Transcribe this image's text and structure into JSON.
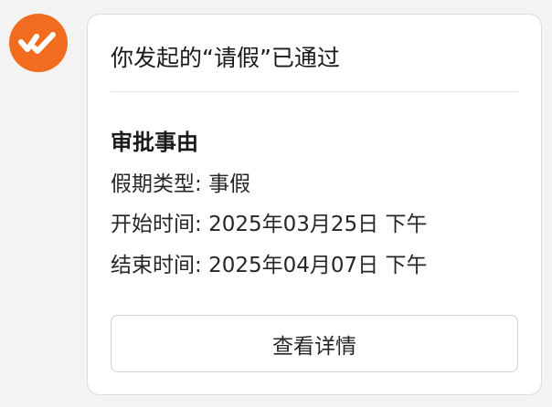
{
  "avatar": {
    "icon": "check-double-icon",
    "color": "#f26c1f"
  },
  "card": {
    "title": "你发起的“请假”已通过",
    "section_heading": "审批事由",
    "fields": [
      {
        "label": "假期类型:",
        "value": "事假"
      },
      {
        "label": "开始时间:",
        "value": "2025年03月25日 下午"
      },
      {
        "label": "结束时间:",
        "value": "2025年04月07日 下午"
      }
    ],
    "detail_button_label": "查看详情"
  }
}
